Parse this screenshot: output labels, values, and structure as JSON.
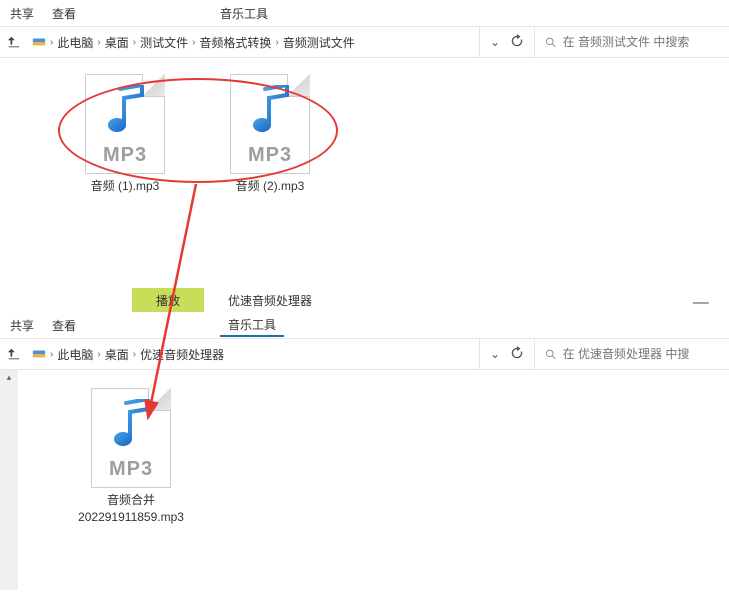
{
  "top": {
    "menu": {
      "share": "共享",
      "view": "查看",
      "musicTools": "音乐工具"
    },
    "breadcrumb": [
      "此电脑",
      "桌面",
      "测试文件",
      "音频格式转换",
      "音频测试文件"
    ],
    "search": {
      "placeholder": "在 音频测试文件 中搜索"
    },
    "files": [
      {
        "name": "音频 (1).mp3"
      },
      {
        "name": "音频 (2).mp3"
      }
    ]
  },
  "bottom": {
    "tabPlay": "播放",
    "winTitle": "优速音频处理器",
    "menu": {
      "share": "共享",
      "view": "查看",
      "musicTools": "音乐工具"
    },
    "breadcrumb": [
      "此电脑",
      "桌面",
      "优速音频处理器"
    ],
    "search": {
      "placeholder": "在 优速音频处理器 中搜"
    },
    "files": [
      {
        "name": "音频合并202291911859.mp3",
        "line1": "音频合并",
        "line2": "202291911859.mp3"
      }
    ]
  }
}
